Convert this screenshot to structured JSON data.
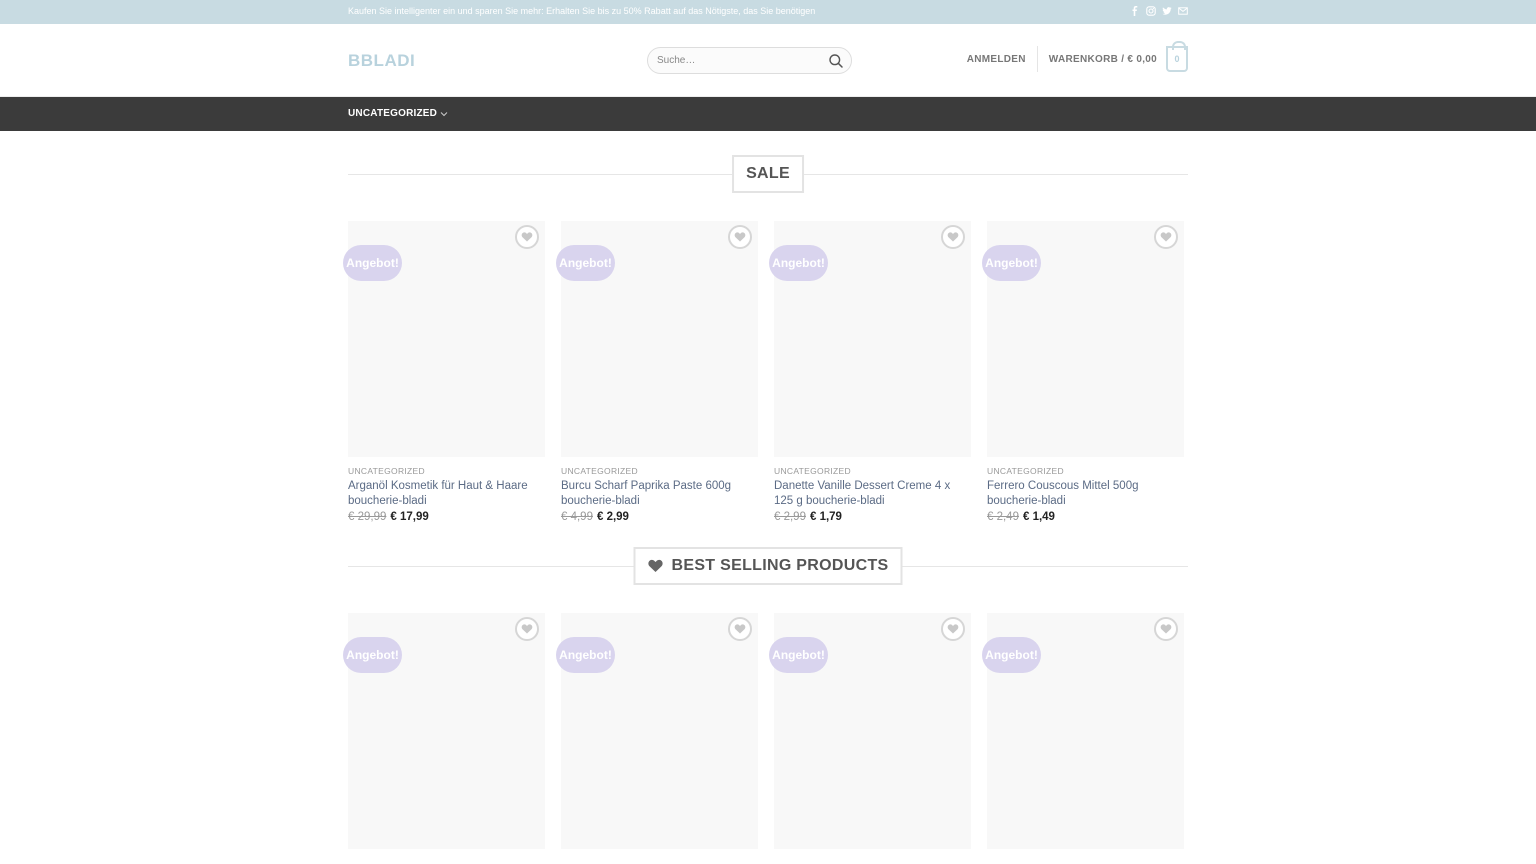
{
  "topbar": {
    "text": "Kaufen Sie intelligenter ein und sparen Sie mehr: Erhalten Sie bis zu 50% Rabatt auf das Nötigste, das Sie benötigen",
    "social_icons": [
      "facebook-icon",
      "instagram-icon",
      "twitter-icon",
      "email-icon"
    ]
  },
  "header": {
    "logo": "BBLADI",
    "search_placeholder": "Suche…",
    "login": "ANMELDEN",
    "cart_label": "WARENKORB / € 0,00",
    "cart_count": "0"
  },
  "nav": {
    "items": [
      {
        "label": "UNCATEGORIZED"
      }
    ]
  },
  "sections": [
    {
      "title": "SALE",
      "products": [
        {
          "badge": "Angebot!",
          "category": "UNCATEGORIZED",
          "name": "Arganöl Kosmetik für Haut & Haare boucherie-bladi",
          "old_price": "€ 29,99",
          "new_price": "€ 17,99"
        },
        {
          "badge": "Angebot!",
          "category": "UNCATEGORIZED",
          "name": "Burcu Scharf Paprika Paste 600g boucherie-bladi",
          "old_price": "€ 4,99",
          "new_price": "€ 2,99"
        },
        {
          "badge": "Angebot!",
          "category": "UNCATEGORIZED",
          "name": "Danette Vanille Dessert Creme 4 x 125 g boucherie-bladi",
          "old_price": "€ 2,99",
          "new_price": "€ 1,79"
        },
        {
          "badge": "Angebot!",
          "category": "UNCATEGORIZED",
          "name": "Ferrero Couscous Mittel 500g boucherie-bladi",
          "old_price": "€ 2,49",
          "new_price": "€ 1,49"
        }
      ]
    },
    {
      "title": "BEST SELLING PRODUCTS",
      "products": [
        {
          "badge": "Angebot!"
        },
        {
          "badge": "Angebot!"
        },
        {
          "badge": "Angebot!"
        },
        {
          "badge": "Angebot!"
        }
      ]
    }
  ],
  "colors": {
    "topbar_bg": "#c8dbe2",
    "nav_bg": "#3b3b3b",
    "badge_bg": "#d9d4ee",
    "product_link": "#5b6b85"
  }
}
